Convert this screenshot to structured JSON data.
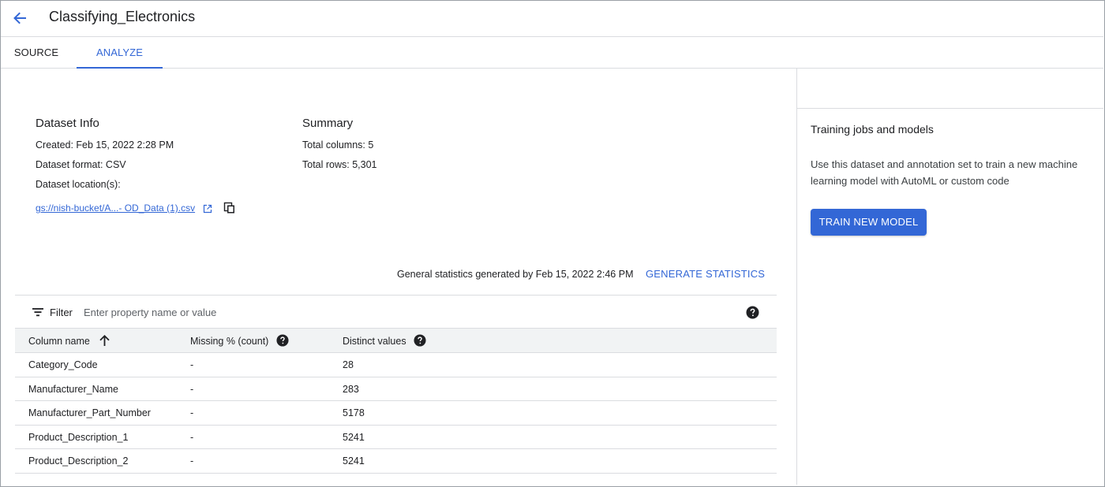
{
  "header": {
    "back_icon": "arrow-back-icon",
    "title": "Classifying_Electronics"
  },
  "tabs": [
    {
      "label": "SOURCE",
      "active": false
    },
    {
      "label": "ANALYZE",
      "active": true
    }
  ],
  "dataset_info": {
    "title": "Dataset Info",
    "created": "Created: Feb 15, 2022 2:28 PM",
    "format": "Dataset format: CSV",
    "location_label": "Dataset location(s):",
    "location_link": "gs://nish-bucket/A...- OD_Data (1).csv",
    "link_icon": "open-in-new-icon",
    "copy_icon": "copy-icon"
  },
  "summary": {
    "title": "Summary",
    "total_columns": "Total columns: 5",
    "total_rows": "Total rows: 5,301"
  },
  "statistics": {
    "generated_text": "General statistics generated by Feb 15, 2022 2:46 PM",
    "generate_button": "GENERATE STATISTICS"
  },
  "filter": {
    "icon": "filter-list-icon",
    "label": "Filter",
    "placeholder": "Enter property name or value",
    "help_icon": "help-icon"
  },
  "table": {
    "headers": [
      "Column name",
      "Missing % (count)",
      "Distinct values"
    ],
    "sort_icon": "arrow-upward-icon",
    "rows": [
      [
        "Category_Code",
        "-",
        "28"
      ],
      [
        "Manufacturer_Name",
        "-",
        "283"
      ],
      [
        "Manufacturer_Part_Number",
        "-",
        "5178"
      ],
      [
        "Product_Description_1",
        "-",
        "5241"
      ],
      [
        "Product_Description_2",
        "-",
        "5241"
      ]
    ]
  },
  "side_panel": {
    "title": "Training jobs and models",
    "description": "Use this dataset and annotation set to train a new machine learning model with AutoML or custom code",
    "button": "TRAIN NEW MODEL"
  },
  "colors": {
    "accent": "#3367d6",
    "divider": "#dadce0",
    "table_header_bg": "#f1f3f4",
    "text": "#202124"
  }
}
